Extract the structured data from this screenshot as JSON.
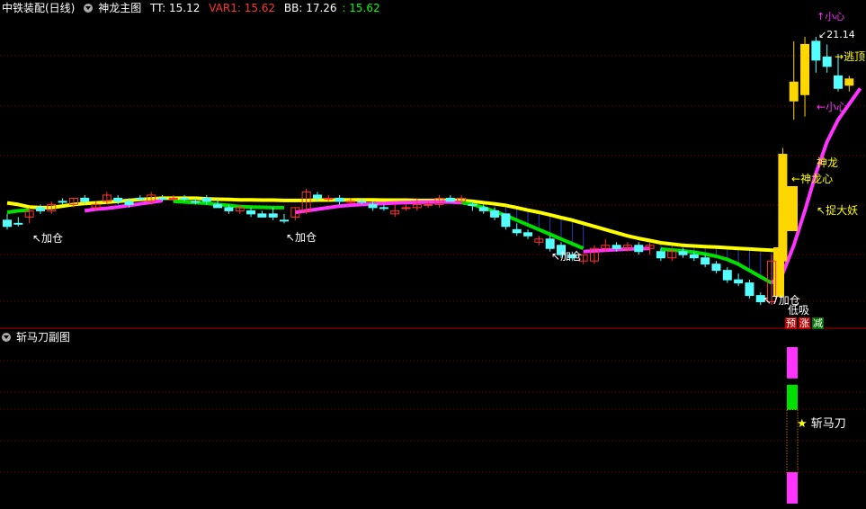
{
  "main_header": {
    "stock": "中铁装配(日线)",
    "indicator": "神龙主图",
    "tt": "TT: 15.12",
    "var1": "VAR1: 15.62",
    "bb": "BB: 17.26",
    "last": ": 15.62"
  },
  "sub_header": {
    "indicator": "斩马刀副图"
  },
  "annotations": {
    "jiacang": "加仓",
    "jiacang_arrow": "↖加仓",
    "high": "21.14",
    "taoding": "逃顶",
    "xiaoxin": "小心",
    "xiaoxin_top": "小心",
    "shenlong": "神龙",
    "shenlongxin": "神龙心",
    "zhuodayao": "捉大妖",
    "dixi": "低吸",
    "jiacang_low": "加仓",
    "low_num": "7",
    "yu": "预",
    "zhang": "涨",
    "jian": "减",
    "zhanmadao": "斩马刀",
    "star": "★"
  },
  "colors": {
    "background": "#000000",
    "up_candle": "#ff3333",
    "down_candle": "#54ffff",
    "yellow_line": "#ffff00",
    "magenta_line": "#ff33ff",
    "green_line": "#00e000",
    "signal_bar": "#ffd700",
    "grid": "#800000",
    "var1_text": "#ff3333",
    "last_text": "#00ff00"
  },
  "chart_data": {
    "type": "candlestick",
    "title": "神龙主图",
    "candles": [
      {
        "o": 15.3,
        "h": 15.5,
        "l": 15.0,
        "c": 15.1,
        "d": 1
      },
      {
        "o": 15.2,
        "h": 15.4,
        "l": 15.1,
        "c": 15.2,
        "d": 1
      },
      {
        "o": 15.4,
        "h": 15.7,
        "l": 15.2,
        "c": 15.6,
        "d": 0
      },
      {
        "o": 15.7,
        "h": 15.8,
        "l": 15.5,
        "c": 15.6,
        "d": 1
      },
      {
        "o": 15.6,
        "h": 15.9,
        "l": 15.5,
        "c": 15.8,
        "d": 0
      },
      {
        "o": 15.9,
        "h": 16.0,
        "l": 15.8,
        "c": 15.9,
        "d": 1
      },
      {
        "o": 15.8,
        "h": 16.0,
        "l": 15.7,
        "c": 16.0,
        "d": 0
      },
      {
        "o": 16.0,
        "h": 16.1,
        "l": 15.8,
        "c": 15.9,
        "d": 1
      },
      {
        "o": 15.7,
        "h": 15.9,
        "l": 15.6,
        "c": 15.8,
        "d": 0
      },
      {
        "o": 15.9,
        "h": 16.2,
        "l": 15.8,
        "c": 16.1,
        "d": 0
      },
      {
        "o": 16.0,
        "h": 16.1,
        "l": 15.8,
        "c": 15.9,
        "d": 1
      },
      {
        "o": 15.9,
        "h": 16.0,
        "l": 15.7,
        "c": 15.8,
        "d": 1
      },
      {
        "o": 16.0,
        "h": 16.1,
        "l": 15.9,
        "c": 16.0,
        "d": 1
      },
      {
        "o": 15.9,
        "h": 16.2,
        "l": 15.8,
        "c": 16.1,
        "d": 0
      },
      {
        "o": 16.0,
        "h": 16.1,
        "l": 15.9,
        "c": 16.0,
        "d": 1
      },
      {
        "o": 16.0,
        "h": 16.1,
        "l": 15.9,
        "c": 16.0,
        "d": 0
      },
      {
        "o": 16.0,
        "h": 16.1,
        "l": 15.9,
        "c": 16.0,
        "d": 1
      },
      {
        "o": 15.9,
        "h": 16.0,
        "l": 15.8,
        "c": 15.9,
        "d": 1
      },
      {
        "o": 16.0,
        "h": 16.1,
        "l": 15.8,
        "c": 15.9,
        "d": 1
      },
      {
        "o": 15.8,
        "h": 16.0,
        "l": 15.7,
        "c": 15.7,
        "d": 1
      },
      {
        "o": 15.7,
        "h": 15.8,
        "l": 15.5,
        "c": 15.6,
        "d": 1
      },
      {
        "o": 15.6,
        "h": 15.8,
        "l": 15.5,
        "c": 15.7,
        "d": 0
      },
      {
        "o": 15.6,
        "h": 15.7,
        "l": 15.4,
        "c": 15.5,
        "d": 1
      },
      {
        "o": 15.4,
        "h": 15.6,
        "l": 15.4,
        "c": 15.5,
        "d": 1
      },
      {
        "o": 15.5,
        "h": 15.7,
        "l": 15.3,
        "c": 15.4,
        "d": 1
      },
      {
        "o": 15.3,
        "h": 15.5,
        "l": 15.2,
        "c": 15.3,
        "d": 1
      },
      {
        "o": 15.4,
        "h": 15.7,
        "l": 15.3,
        "c": 15.7,
        "d": 0
      },
      {
        "o": 15.6,
        "h": 16.3,
        "l": 15.5,
        "c": 16.2,
        "d": 0
      },
      {
        "o": 16.1,
        "h": 16.2,
        "l": 15.9,
        "c": 16.0,
        "d": 1
      },
      {
        "o": 16.0,
        "h": 16.1,
        "l": 15.9,
        "c": 16.0,
        "d": 0
      },
      {
        "o": 16.0,
        "h": 16.1,
        "l": 15.8,
        "c": 15.9,
        "d": 1
      },
      {
        "o": 15.9,
        "h": 16.0,
        "l": 15.8,
        "c": 15.9,
        "d": 0
      },
      {
        "o": 15.9,
        "h": 16.0,
        "l": 15.8,
        "c": 15.9,
        "d": 1
      },
      {
        "o": 15.8,
        "h": 15.9,
        "l": 15.6,
        "c": 15.7,
        "d": 1
      },
      {
        "o": 15.7,
        "h": 15.8,
        "l": 15.6,
        "c": 15.7,
        "d": 1
      },
      {
        "o": 15.6,
        "h": 15.8,
        "l": 15.4,
        "c": 15.5,
        "d": 0
      },
      {
        "o": 15.7,
        "h": 15.8,
        "l": 15.6,
        "c": 15.7,
        "d": 0
      },
      {
        "o": 15.7,
        "h": 16.0,
        "l": 15.6,
        "c": 15.8,
        "d": 0
      },
      {
        "o": 15.8,
        "h": 15.9,
        "l": 15.7,
        "c": 15.8,
        "d": 0
      },
      {
        "o": 15.8,
        "h": 16.1,
        "l": 15.7,
        "c": 16.0,
        "d": 0
      },
      {
        "o": 16.0,
        "h": 16.1,
        "l": 15.9,
        "c": 15.9,
        "d": 1
      },
      {
        "o": 15.9,
        "h": 16.1,
        "l": 15.9,
        "c": 16.0,
        "d": 0
      },
      {
        "o": 15.8,
        "h": 15.9,
        "l": 15.6,
        "c": 15.8,
        "d": 1
      },
      {
        "o": 15.7,
        "h": 15.8,
        "l": 15.5,
        "c": 15.6,
        "d": 1
      },
      {
        "o": 15.6,
        "h": 15.7,
        "l": 15.3,
        "c": 15.4,
        "d": 1
      },
      {
        "o": 15.5,
        "h": 15.5,
        "l": 15.0,
        "c": 15.1,
        "d": 1
      },
      {
        "o": 15.0,
        "h": 15.2,
        "l": 14.8,
        "c": 14.9,
        "d": 1
      },
      {
        "o": 14.9,
        "h": 15.0,
        "l": 14.7,
        "c": 14.8,
        "d": 1
      },
      {
        "o": 14.6,
        "h": 14.8,
        "l": 14.5,
        "c": 14.7,
        "d": 0
      },
      {
        "o": 14.7,
        "h": 14.8,
        "l": 14.3,
        "c": 14.4,
        "d": 1
      },
      {
        "o": 14.5,
        "h": 14.6,
        "l": 14.1,
        "c": 14.2,
        "d": 1
      },
      {
        "o": 14.2,
        "h": 14.3,
        "l": 14.0,
        "c": 14.1,
        "d": 1
      },
      {
        "o": 14.0,
        "h": 14.2,
        "l": 13.9,
        "c": 14.2,
        "d": 0
      },
      {
        "o": 14.0,
        "h": 14.5,
        "l": 13.9,
        "c": 14.4,
        "d": 0
      },
      {
        "o": 14.4,
        "h": 14.7,
        "l": 14.3,
        "c": 14.5,
        "d": 0
      },
      {
        "o": 14.5,
        "h": 14.6,
        "l": 14.3,
        "c": 14.4,
        "d": 1
      },
      {
        "o": 14.4,
        "h": 14.6,
        "l": 14.3,
        "c": 14.5,
        "d": 0
      },
      {
        "o": 14.5,
        "h": 14.6,
        "l": 14.2,
        "c": 14.3,
        "d": 1
      },
      {
        "o": 14.4,
        "h": 14.6,
        "l": 14.2,
        "c": 14.5,
        "d": 0
      },
      {
        "o": 14.3,
        "h": 14.4,
        "l": 14.0,
        "c": 14.1,
        "d": 1
      },
      {
        "o": 14.1,
        "h": 14.4,
        "l": 14.0,
        "c": 14.3,
        "d": 0
      },
      {
        "o": 14.3,
        "h": 14.4,
        "l": 14.1,
        "c": 14.2,
        "d": 1
      },
      {
        "o": 14.2,
        "h": 14.3,
        "l": 14.0,
        "c": 14.1,
        "d": 1
      },
      {
        "o": 14.1,
        "h": 14.2,
        "l": 13.8,
        "c": 13.9,
        "d": 1
      },
      {
        "o": 13.9,
        "h": 14.0,
        "l": 13.6,
        "c": 13.7,
        "d": 1
      },
      {
        "o": 13.7,
        "h": 13.8,
        "l": 13.3,
        "c": 13.4,
        "d": 1
      },
      {
        "o": 13.4,
        "h": 13.6,
        "l": 13.2,
        "c": 13.3,
        "d": 1
      },
      {
        "o": 13.3,
        "h": 13.4,
        "l": 12.8,
        "c": 12.9,
        "d": 1
      },
      {
        "o": 12.9,
        "h": 13.0,
        "l": 12.6,
        "c": 12.7,
        "d": 1
      },
      {
        "o": 12.7,
        "h": 14.2,
        "l": 12.6,
        "c": 14.0,
        "d": 0
      },
      {
        "o": 14.0,
        "h": 17.6,
        "l": 14.0,
        "c": 17.4,
        "d": 0
      },
      {
        "o": 19.1,
        "h": 21.0,
        "l": 18.5,
        "c": 19.7,
        "d": 0
      },
      {
        "o": 19.3,
        "h": 21.14,
        "l": 18.6,
        "c": 20.9,
        "d": 0
      },
      {
        "o": 21.0,
        "h": 21.14,
        "l": 20.0,
        "c": 20.4,
        "d": 1
      },
      {
        "o": 20.5,
        "h": 20.9,
        "l": 20.0,
        "c": 20.2,
        "d": 1
      },
      {
        "o": 19.9,
        "h": 20.6,
        "l": 19.4,
        "c": 19.5,
        "d": 1
      },
      {
        "o": 19.6,
        "h": 19.9,
        "l": 19.4,
        "c": 19.8,
        "d": 0
      }
    ],
    "yellow_line": [
      15.85,
      15.8,
      15.72,
      15.7,
      15.7,
      15.75,
      15.8,
      15.83,
      15.85,
      15.87,
      15.9,
      15.93,
      15.96,
      15.98,
      16.0,
      16.0,
      16.0,
      16.0,
      15.98,
      15.97,
      15.96,
      15.95,
      15.95,
      15.94,
      15.94,
      15.93,
      15.93,
      15.93,
      15.94,
      15.94,
      15.95,
      15.95,
      15.95,
      15.95,
      15.94,
      15.94,
      15.94,
      15.93,
      15.93,
      15.93,
      15.94,
      15.93,
      15.9,
      15.86,
      15.82,
      15.77,
      15.7,
      15.62,
      15.55,
      15.47,
      15.38,
      15.3,
      15.2,
      15.1,
      15.0,
      14.9,
      14.8,
      14.72,
      14.65,
      14.58,
      14.54,
      14.5,
      14.48,
      14.46,
      14.44,
      14.42,
      14.4,
      14.38,
      14.36,
      14.34,
      14.33,
      null,
      null,
      null,
      null,
      null,
      null,
      null
    ],
    "magenta_line": [
      null,
      null,
      null,
      null,
      null,
      null,
      null,
      15.6,
      15.65,
      15.68,
      15.72,
      15.77,
      15.82,
      15.87,
      15.92,
      null,
      null,
      null,
      null,
      null,
      null,
      null,
      null,
      null,
      null,
      null,
      15.55,
      15.6,
      15.65,
      15.7,
      15.75,
      15.78,
      15.8,
      15.82,
      15.83,
      15.85,
      15.86,
      15.87,
      15.88,
      15.88,
      15.88,
      15.86,
      null,
      null,
      null,
      null,
      null,
      null,
      null,
      null,
      null,
      null,
      14.3,
      14.32,
      14.34,
      14.36,
      14.38,
      14.39,
      14.4,
      null,
      null,
      null,
      null,
      null,
      null,
      null,
      null,
      null,
      null,
      13.3,
      13.6,
      14.5,
      15.6,
      16.8,
      17.8,
      18.5,
      19.0,
      19.5
    ],
    "green_line": [
      15.55,
      15.6,
      15.62,
      null,
      null,
      null,
      null,
      null,
      null,
      null,
      null,
      null,
      null,
      null,
      null,
      15.9,
      15.88,
      15.86,
      15.84,
      15.8,
      15.77,
      15.73,
      15.72,
      15.71,
      15.7,
      15.7,
      null,
      null,
      null,
      null,
      null,
      null,
      null,
      null,
      null,
      null,
      null,
      null,
      null,
      null,
      null,
      15.86,
      15.8,
      15.7,
      15.58,
      15.45,
      15.3,
      15.15,
      15.0,
      14.85,
      14.7,
      14.55,
      14.4,
      null,
      null,
      null,
      null,
      null,
      null,
      14.38,
      14.35,
      14.32,
      14.28,
      14.22,
      14.15,
      14.05,
      13.9,
      13.7,
      13.5,
      13.3,
      null,
      null,
      null,
      null,
      null,
      null,
      null,
      null
    ],
    "axis": {
      "ymin": 12.0,
      "ymax": 21.8
    },
    "sub_chart": {
      "name": "斩马刀副图",
      "bars": [
        {
          "index": 69,
          "segments": [
            {
              "from": 0.0,
              "to": 0.22,
              "color": "#ff33ff"
            },
            {
              "from": 0.22,
              "to": 0.78,
              "color": "dashed"
            },
            {
              "from": 0.78,
              "to": 0.95,
              "color": "#00e000"
            },
            {
              "from": 0.95,
              "to": 1.0,
              "color": "none"
            },
            {
              "from": 1.0,
              "to": 1.0,
              "color": "#ff33ff"
            }
          ]
        }
      ]
    },
    "grid": true
  }
}
